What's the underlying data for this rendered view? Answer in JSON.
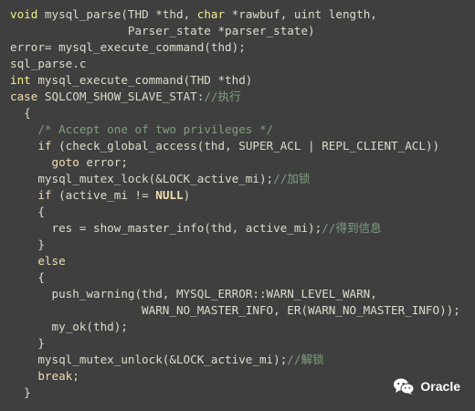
{
  "code": {
    "lines": [
      [
        {
          "t": "void",
          "c": "type"
        },
        {
          "t": " mysql_parse(THD *thd, ",
          "c": "plain"
        },
        {
          "t": "char",
          "c": "type"
        },
        {
          "t": " *rawbuf, uint length,",
          "c": "plain"
        }
      ],
      [
        {
          "t": "                 Parser_state *parser_state)",
          "c": "plain"
        }
      ],
      [
        {
          "t": "error= mysql_execute_command(thd);",
          "c": "plain"
        }
      ],
      [
        {
          "t": "sql_parse.c",
          "c": "plain"
        }
      ],
      [
        {
          "t": "int",
          "c": "type"
        },
        {
          "t": " mysql_execute_command(THD *thd)",
          "c": "plain"
        }
      ],
      [
        {
          "t": "case",
          "c": "kw"
        },
        {
          "t": " SQLCOM_SHOW_SLAVE_STAT:",
          "c": "plain"
        },
        {
          "t": "//执行",
          "c": "cmt"
        }
      ],
      [
        {
          "t": "  {",
          "c": "plain"
        }
      ],
      [
        {
          "t": "    ",
          "c": "plain"
        },
        {
          "t": "/* Accept one of two privileges */",
          "c": "cmt"
        }
      ],
      [
        {
          "t": "    ",
          "c": "plain"
        },
        {
          "t": "if",
          "c": "kw"
        },
        {
          "t": " (check_global_access(thd, SUPER_ACL | REPL_CLIENT_ACL))",
          "c": "plain"
        }
      ],
      [
        {
          "t": "      ",
          "c": "plain"
        },
        {
          "t": "goto",
          "c": "kw"
        },
        {
          "t": " error;",
          "c": "plain"
        }
      ],
      [
        {
          "t": "    mysql_mutex_lock(&LOCK_active_mi);",
          "c": "plain"
        },
        {
          "t": "//加锁",
          "c": "cmt"
        }
      ],
      [
        {
          "t": "    ",
          "c": "plain"
        },
        {
          "t": "if",
          "c": "kw"
        },
        {
          "t": " (active_mi != ",
          "c": "plain"
        },
        {
          "t": "NULL",
          "c": "null"
        },
        {
          "t": ")",
          "c": "plain"
        }
      ],
      [
        {
          "t": "    {",
          "c": "plain"
        }
      ],
      [
        {
          "t": "      res = show_master_info(thd, active_mi);",
          "c": "plain"
        },
        {
          "t": "//得到信息",
          "c": "cmt"
        }
      ],
      [
        {
          "t": "    }",
          "c": "plain"
        }
      ],
      [
        {
          "t": "    ",
          "c": "plain"
        },
        {
          "t": "else",
          "c": "kw"
        }
      ],
      [
        {
          "t": "    {",
          "c": "plain"
        }
      ],
      [
        {
          "t": "      push_warning(thd, MYSQL_ERROR::WARN_LEVEL_WARN,",
          "c": "plain"
        }
      ],
      [
        {
          "t": "                   WARN_NO_MASTER_INFO, ER(WARN_NO_MASTER_INFO));",
          "c": "plain"
        }
      ],
      [
        {
          "t": "      my_ok(thd);",
          "c": "plain"
        }
      ],
      [
        {
          "t": "    }",
          "c": "plain"
        }
      ],
      [
        {
          "t": "    mysql_mutex_unlock(&LOCK_active_mi);",
          "c": "plain"
        },
        {
          "t": "//解锁",
          "c": "cmt"
        }
      ],
      [
        {
          "t": "    ",
          "c": "plain"
        },
        {
          "t": "break",
          "c": "kw"
        },
        {
          "t": ";",
          "c": "plain"
        }
      ],
      [
        {
          "t": "  }",
          "c": "plain"
        }
      ]
    ]
  },
  "watermark": {
    "icon": "wechat-icon",
    "text": "Oracle"
  },
  "colors": {
    "background": "#3f3f3f",
    "text": "#dcdccc",
    "keyword": "#f0dfaf",
    "type": "#efef8f",
    "comment": "#7f9f7f"
  }
}
